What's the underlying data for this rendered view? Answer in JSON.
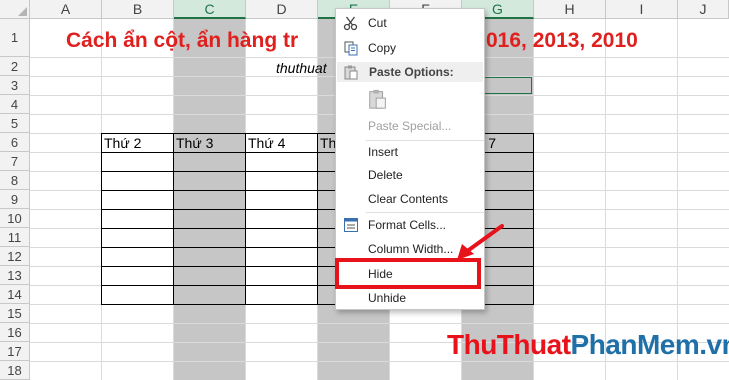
{
  "spreadsheet": {
    "columns": [
      "A",
      "B",
      "C",
      "D",
      "E",
      "F",
      "G",
      "H",
      "I",
      "J"
    ],
    "selected_columns": [
      "C",
      "E",
      "G"
    ],
    "rows": [
      "1",
      "2",
      "3",
      "4",
      "5",
      "6",
      "7",
      "8",
      "9",
      "10",
      "11",
      "12",
      "13",
      "14",
      "15",
      "16",
      "17",
      "18"
    ],
    "title": "Cách ẩn cột, ẩn hàng tr",
    "title_tail": "016, 2013, 2010",
    "subtitle": "thuthuat",
    "table_headers": [
      "Thứ 2",
      "Thứ 3",
      "Thứ 4",
      "Th",
      "ứ 7"
    ],
    "title_color": "#e0201e",
    "selection_color": "#217346"
  },
  "context_menu": {
    "items": {
      "cut": "Cut",
      "copy": "Copy",
      "paste_options": "Paste Options:",
      "paste_special": "Paste Special...",
      "insert": "Insert",
      "delete": "Delete",
      "clear_contents": "Clear Contents",
      "format_cells": "Format Cells...",
      "column_width": "Column Width...",
      "hide": "Hide",
      "unhide": "Unhide"
    },
    "icons": [
      "scissors-icon",
      "copy-icon",
      "paste-icon",
      "clipboard-icon",
      "format-cells-icon"
    ],
    "highlight_color": "#e8121b"
  },
  "watermark": {
    "part1": "ThuThuat",
    "part2": "PhanMem",
    "part3": ".vn"
  }
}
